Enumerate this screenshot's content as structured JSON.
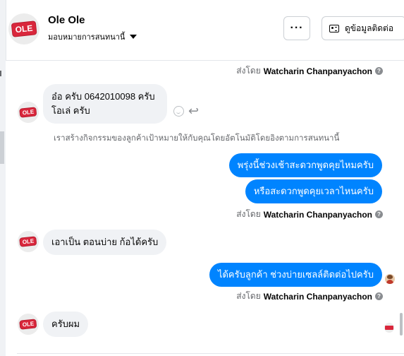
{
  "header": {
    "name": "Ole Ole",
    "subtitle": "มอบหมายการสนทนานี้",
    "avatar_text": "OLE",
    "more_label": "···",
    "profile_button_label": "ดูข้อมูลติดต่อ"
  },
  "sender_label": "ส่งโดย",
  "agent_name": "Watcharin Chanpanyachon",
  "messages": [
    {
      "line1": "อ๋อ ครับ 0642010098 ครับ",
      "line2": "โอเล่ ครับ"
    },
    {
      "text": "พรุ่งนี้ช่วงเช้าสะดวกพูดคุยไหมครับ"
    },
    {
      "text": "หรือสะดวกพูดคุยเวลาไหนครับ"
    },
    {
      "text": "เอาเป็น ตอนบ่าย ก้อได้ครับ"
    },
    {
      "text": "ได้ครับลูกค้า ช่วงบ่ายเซลล์ติดต่อไปครับ"
    },
    {
      "text": "ครับผม"
    }
  ],
  "system_note": "เราสร้างกิจกรรมของลูกค้าเป้าหมายให้กับคุณโดยอัตโนมัติโดยอิงตามการสนทนานี้",
  "icons": {
    "info": "info-icon",
    "reaction": "smile-icon",
    "reply": "reply-icon",
    "caret": "caret-down-icon",
    "profile": "id-card-icon"
  },
  "colors": {
    "outgoing_bubble": "#0084ff",
    "incoming_bubble": "#f0f2f5",
    "brand_badge": "#d9263b"
  }
}
